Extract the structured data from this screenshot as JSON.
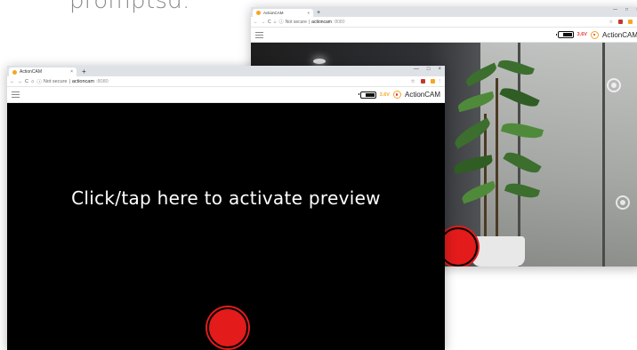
{
  "heading": "promptsd.",
  "back_window": {
    "tab_title": "ActionCAM",
    "tab_close": "×",
    "new_tab": "+",
    "window_controls": [
      "—",
      "□",
      "×"
    ],
    "nav": [
      "←",
      "→",
      "C",
      "⌂"
    ],
    "security": "Not secure",
    "url_host": "actioncam",
    "url_port": ":8080",
    "battery_voltage": "3.6V",
    "app_name": "ActionCAM"
  },
  "front_window": {
    "tab_title": "ActionCAM",
    "tab_close": "×",
    "new_tab": "+",
    "window_controls": [
      "—",
      "□",
      "×"
    ],
    "nav": [
      "←",
      "→",
      "C",
      "⌂"
    ],
    "security": "Not secure",
    "url_host": "actioncam",
    "url_port": ":8080",
    "battery_voltage": "3.6V",
    "battery_level": 0.6,
    "app_name": "ActionCAM",
    "preview_prompt": "Click/tap here to activate preview"
  },
  "colors": {
    "record": "#e31b1b",
    "accent": "#f5a623",
    "viewport": "#000000"
  }
}
